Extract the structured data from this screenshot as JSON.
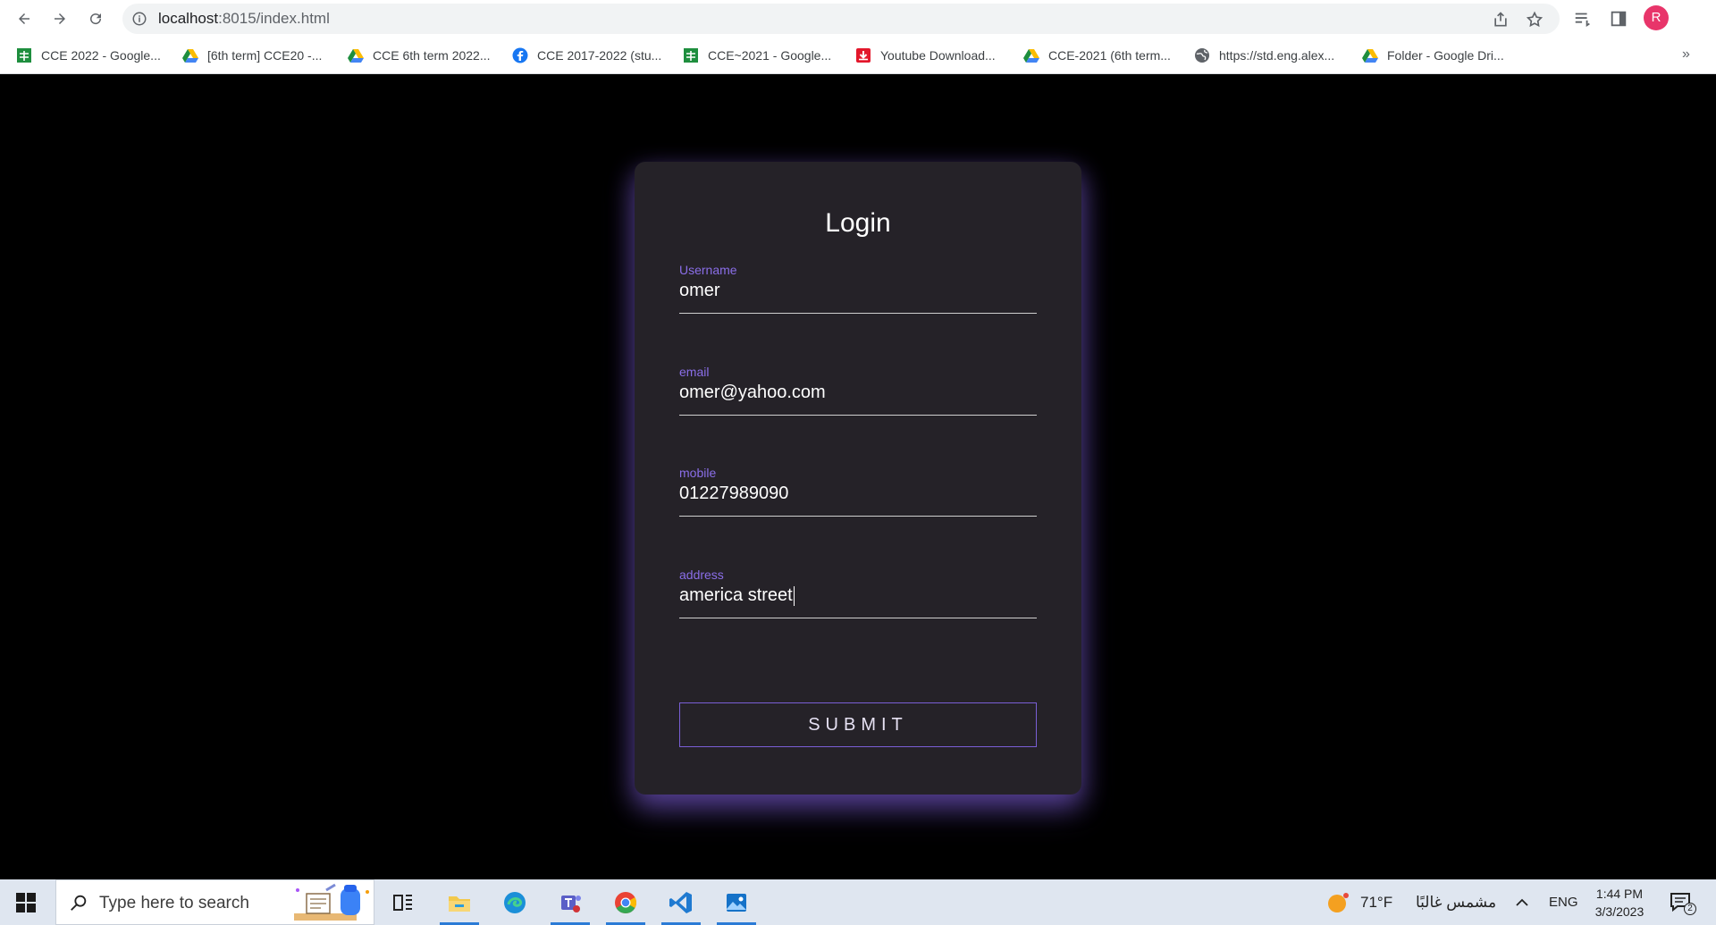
{
  "browser": {
    "url_host": "localhost",
    "url_path": ":8015/index.html",
    "profile_initial": "R",
    "bookmarks": [
      {
        "label": "CCE 2022 - Google...",
        "icon": "google-sheets-icon"
      },
      {
        "label": "[6th term] CCE20 -...",
        "icon": "google-drive-icon"
      },
      {
        "label": "CCE 6th term 2022...",
        "icon": "google-drive-icon"
      },
      {
        "label": "CCE 2017-2022 (stu...",
        "icon": "facebook-icon"
      },
      {
        "label": "CCE~2021 - Google...",
        "icon": "google-sheets-icon"
      },
      {
        "label": "Youtube Download...",
        "icon": "youtube-download-icon"
      },
      {
        "label": "CCE-2021 (6th term...",
        "icon": "google-drive-icon"
      },
      {
        "label": "https://std.eng.alex...",
        "icon": "globe-icon"
      },
      {
        "label": "Folder - Google Dri...",
        "icon": "google-drive-icon"
      }
    ],
    "more_bookmarks": "»"
  },
  "form": {
    "title": "Login",
    "fields": [
      {
        "label": "Username",
        "value": "omer"
      },
      {
        "label": "email",
        "value": "omer@yahoo.com"
      },
      {
        "label": "mobile",
        "value": "01227989090"
      },
      {
        "label": "address",
        "value": "america street"
      }
    ],
    "submit_label": "SUBMIT",
    "colors": {
      "accent": "#8a6ee8",
      "card": "#252228",
      "glow": "#7c5cd6"
    }
  },
  "taskbar": {
    "search_placeholder": "Type here to search",
    "weather_temp": "71°F",
    "weather_text": "مشمس غالبًا",
    "language": "ENG",
    "time": "1:44 PM",
    "date": "3/3/2023",
    "notification_count": "2"
  }
}
